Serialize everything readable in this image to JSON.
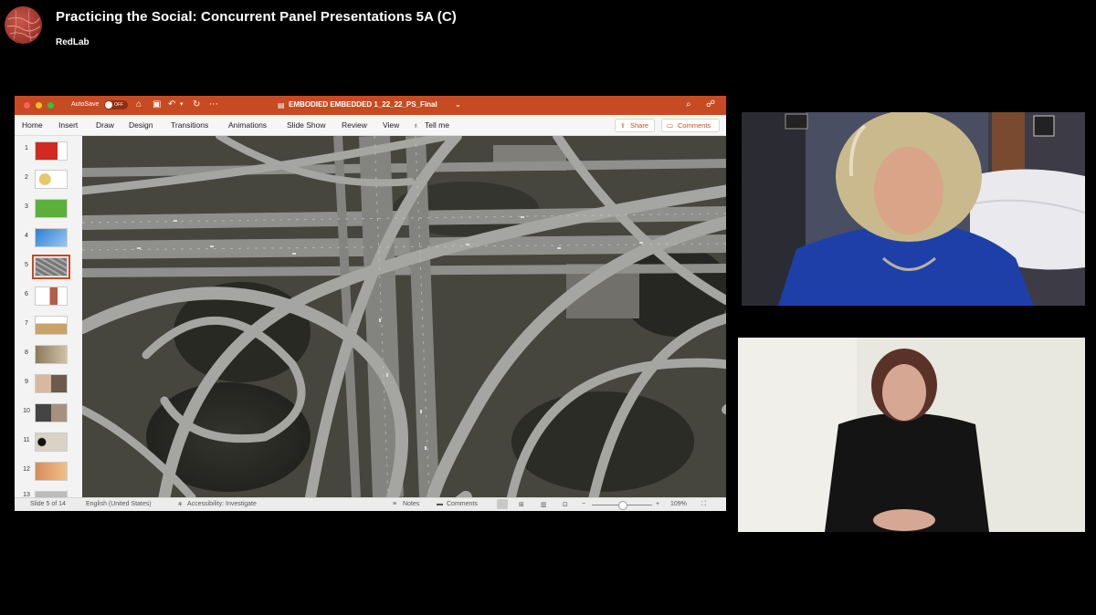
{
  "header": {
    "title": "Practicing the Social: Concurrent Panel Presentations 5A (C)",
    "subtitle": "RedLab"
  },
  "ppt": {
    "autosave_label": "AutoSave",
    "autosave_state": "OFF",
    "doc_title": "EMBODIED EMBEDDED 1_22_22_PS_Final",
    "doc_title_suffix": "⌄",
    "tabs": [
      "Home",
      "Insert",
      "Draw",
      "Design",
      "Transitions",
      "Animations",
      "Slide Show",
      "Review",
      "View",
      "Tell me"
    ],
    "share_label": "Share",
    "comments_label": "Comments",
    "thumbnails": [
      {
        "num": "1"
      },
      {
        "num": "2"
      },
      {
        "num": "3"
      },
      {
        "num": "4"
      },
      {
        "num": "5"
      },
      {
        "num": "6"
      },
      {
        "num": "7"
      },
      {
        "num": "8"
      },
      {
        "num": "9"
      },
      {
        "num": "10"
      },
      {
        "num": "11"
      },
      {
        "num": "12"
      },
      {
        "num": "13"
      }
    ],
    "selected_slide": 5,
    "status": {
      "slide_info": "Slide 5 of 14",
      "language": "English (United States)",
      "accessibility": "Accessibility: Investigate",
      "notes": "Notes",
      "comments": "Comments",
      "zoom_minus": "−",
      "zoom_plus": "+",
      "zoom": "109%"
    },
    "colors": {
      "accent": "#c64a22"
    }
  }
}
